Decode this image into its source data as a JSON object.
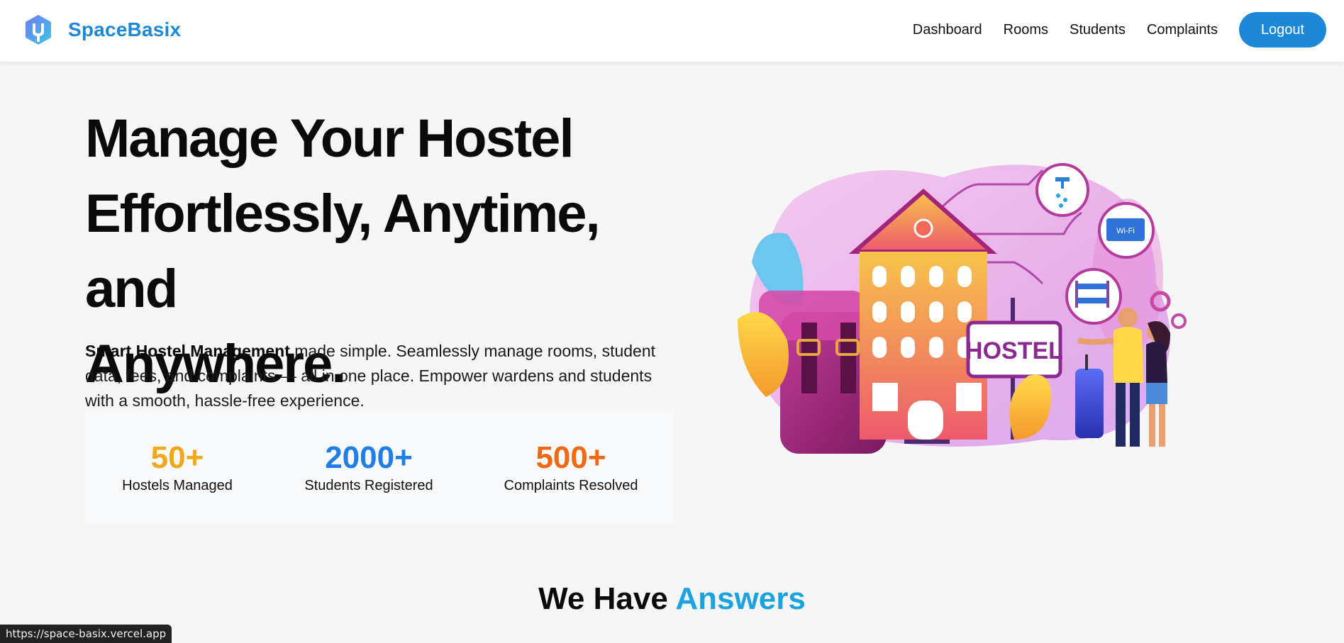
{
  "nav": {
    "brand": "SpaceBasix",
    "links": [
      "Dashboard",
      "Rooms",
      "Students",
      "Complaints"
    ],
    "logout": "Logout"
  },
  "hero": {
    "title_lines": [
      "Manage Your Hostel",
      "Effortlessly, Anytime, and",
      "Anywhere."
    ],
    "desc_bold": "Smart Hostel Management",
    "desc_rest": " made simple. Seamlessly manage rooms, student data, fees, and complaints — all in one place. Empower wardens and students with a smooth, hassle-free experience.",
    "illustration_sign": "HOSTEL",
    "illustration_wifi": "Wi-Fi"
  },
  "stats": [
    {
      "value": "50+",
      "label": "Hostels Managed",
      "color": "#f0a81c"
    },
    {
      "value": "2000+",
      "label": "Students Registered",
      "color": "#1f7ee8"
    },
    {
      "value": "500+",
      "label": "Complaints Resolved",
      "color": "#f06a14"
    }
  ],
  "section": {
    "title_plain": "We Have ",
    "title_accent": "Answers"
  },
  "status_bar": {
    "url": "https://space-basix.vercel.app"
  },
  "colors": {
    "brand": "#1e88d8",
    "accent": "#1aa3e0"
  }
}
